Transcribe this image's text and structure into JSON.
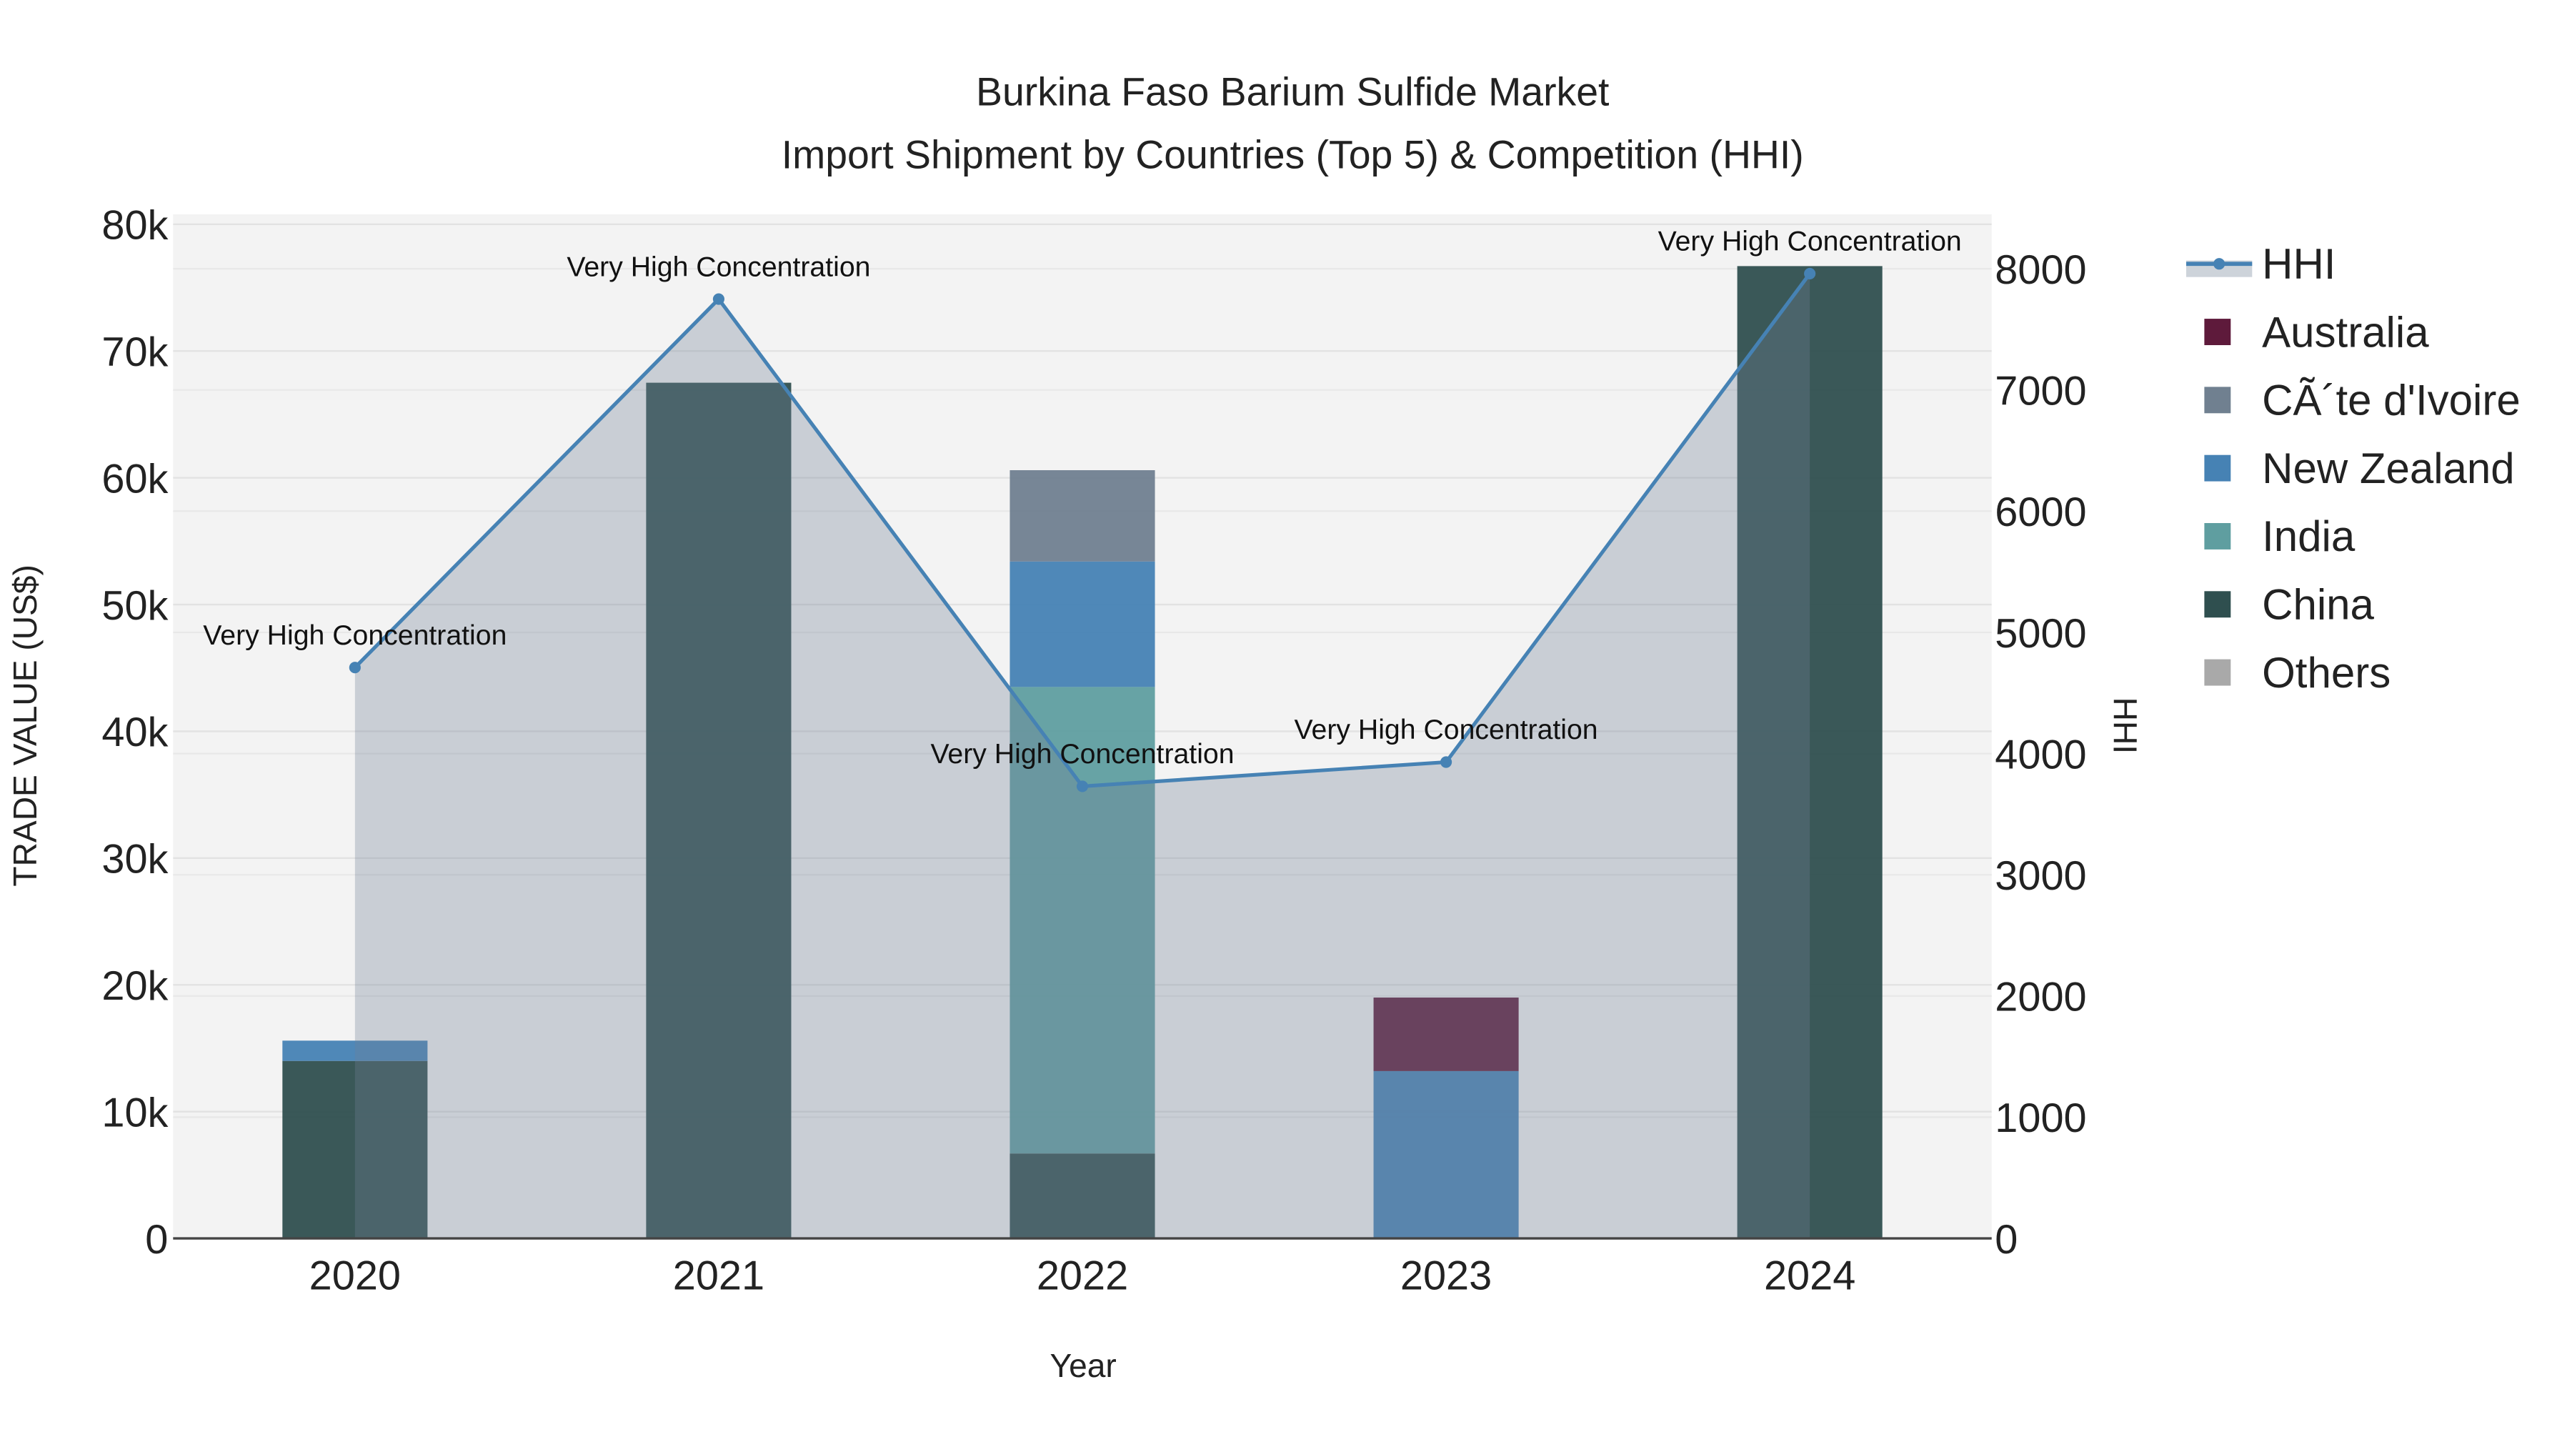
{
  "chart_data": {
    "type": "bar",
    "barmode": "stack",
    "title_line1": "Burkina Faso Barium Sulfide Market",
    "title_line2": "Import Shipment by Countries (Top 5) & Competition (HHI)",
    "xlabel": "Year",
    "ylabel": "TRADE VALUE (US$)",
    "y2label": "HHI",
    "categories": [
      "2020",
      "2021",
      "2022",
      "2023",
      "2024"
    ],
    "ylim": [
      0,
      80000
    ],
    "y_ticks": [
      "0",
      "10k",
      "20k",
      "30k",
      "40k",
      "50k",
      "60k",
      "70k",
      "80k"
    ],
    "y2lim": [
      0,
      8370
    ],
    "y2_ticks": [
      "0",
      "1000",
      "2000",
      "3000",
      "4000",
      "5000",
      "6000",
      "7000",
      "8000"
    ],
    "grid": true,
    "legend_position": "right",
    "series": [
      {
        "name": "China",
        "color": "#2f4f4f",
        "values": [
          14000,
          67500,
          6700,
          0,
          76700
        ]
      },
      {
        "name": "India",
        "color": "#5f9ea0",
        "values": [
          0,
          0,
          36800,
          0,
          0
        ]
      },
      {
        "name": "New Zealand",
        "color": "#4682b4",
        "values": [
          1600,
          0,
          9900,
          13200,
          0
        ]
      },
      {
        "name": "CÃ´te d'Ivoire",
        "color": "#708090",
        "values": [
          0,
          0,
          7200,
          0,
          0
        ]
      },
      {
        "name": "Australia",
        "color": "#5e1a3b",
        "values": [
          0,
          0,
          0,
          5800,
          0
        ]
      },
      {
        "name": "Others",
        "color": "#a9a9a9",
        "values": [
          0,
          0,
          0,
          0,
          0
        ]
      }
    ],
    "hhi": {
      "name": "HHI",
      "color": "#4682b4",
      "values": [
        4710,
        7750,
        3730,
        3930,
        7960
      ],
      "annotations": [
        "Very High Concentration",
        "Very High Concentration",
        "Very High Concentration",
        "Very High Concentration",
        "Very High Concentration"
      ]
    },
    "legend_order": [
      "HHI",
      "Australia",
      "CÃ´te d'Ivoire",
      "New Zealand",
      "India",
      "China",
      "Others"
    ]
  }
}
